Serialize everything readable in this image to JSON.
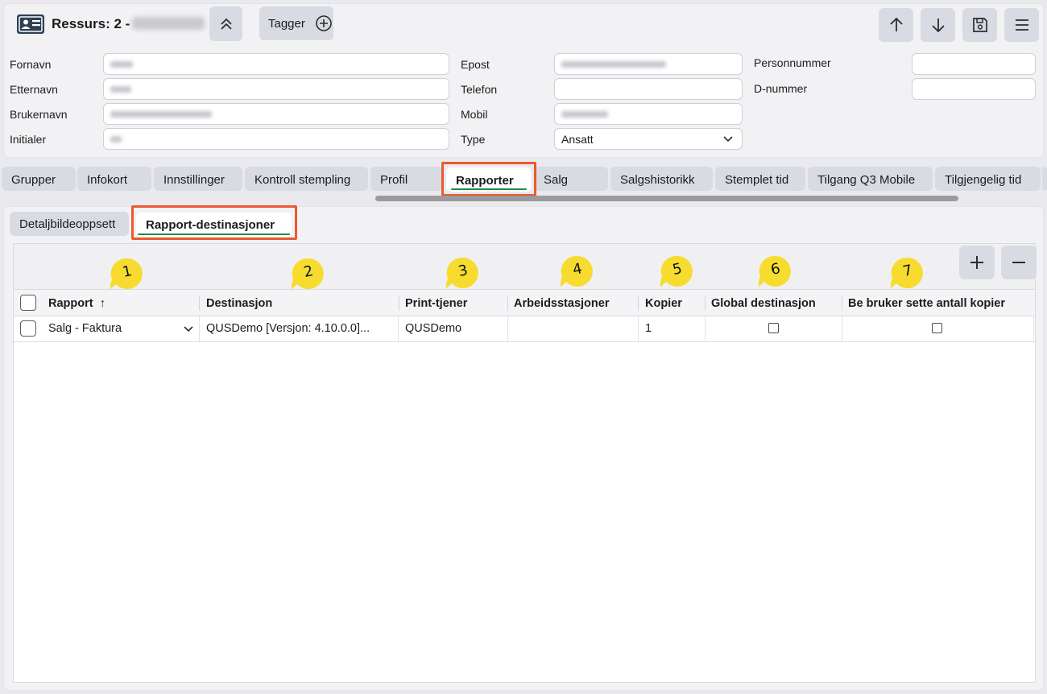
{
  "header": {
    "title": "Ressurs: 2 -",
    "tags_label": "Tagger"
  },
  "form": {
    "fornavn_label": "Fornavn",
    "etternavn_label": "Etternavn",
    "brukernavn_label": "Brukernavn",
    "initialer_label": "Initialer",
    "epost_label": "Epost",
    "telefon_label": "Telefon",
    "mobil_label": "Mobil",
    "type_label": "Type",
    "type_value": "Ansatt",
    "personnummer_label": "Personnummer",
    "dnummer_label": "D-nummer"
  },
  "tabs": [
    {
      "label": "Grupper"
    },
    {
      "label": "Infokort"
    },
    {
      "label": "Innstillinger"
    },
    {
      "label": "Kontroll stempling"
    },
    {
      "label": "Profil"
    },
    {
      "label": "Rapporter"
    },
    {
      "label": "Salg"
    },
    {
      "label": "Salgshistorikk"
    },
    {
      "label": "Stemplet tid"
    },
    {
      "label": "Tilgang Q3 Mobile"
    },
    {
      "label": "Tilgjengelig tid"
    }
  ],
  "subtabs": [
    {
      "label": "Detaljbildeoppsett"
    },
    {
      "label": "Rapport-destinasjoner"
    }
  ],
  "grid": {
    "columns": [
      {
        "label": "Rapport",
        "sort": "↑"
      },
      {
        "label": "Destinasjon"
      },
      {
        "label": "Print-tjener"
      },
      {
        "label": "Arbeidsstasjoner"
      },
      {
        "label": "Kopier"
      },
      {
        "label": "Global destinasjon"
      },
      {
        "label": "Be bruker sette antall kopier"
      }
    ],
    "rows": [
      {
        "rapport": "Salg - Faktura",
        "destinasjon": "QUSDemo [Versjon: 4.10.0.0]...",
        "print_tjener": "QUSDemo",
        "arbeidsstasjoner": "",
        "kopier": "1",
        "global_destinasjon": false,
        "be_bruker": false
      }
    ]
  },
  "callouts": [
    "1",
    "2",
    "3",
    "4",
    "5",
    "6",
    "7"
  ],
  "colors": {
    "highlight": "#ea5a2c",
    "callout": "#f7dc2f",
    "active_underline": "#1e8e3e"
  }
}
